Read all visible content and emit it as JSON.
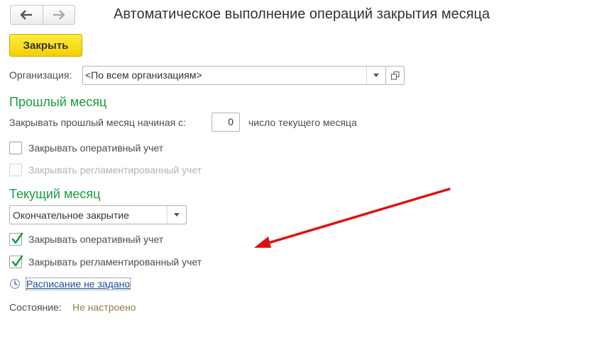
{
  "window": {
    "title": "Автоматическое выполнение операций закрытия месяца"
  },
  "nav": {
    "back_icon": "arrow-left-icon",
    "forward_icon": "arrow-right-icon"
  },
  "toolbar": {
    "close_label": "Закрыть"
  },
  "organization": {
    "label": "Организация:",
    "value": "<По всем организациям>"
  },
  "previous_month": {
    "title": "Прошлый месяц",
    "start_label": "Закрывать прошлый месяц начиная с:",
    "start_value": "0",
    "start_suffix": "число текущего месяца",
    "operational": {
      "label": "Закрывать оперативный учет",
      "checked": false,
      "enabled": true
    },
    "regulated": {
      "label": "Закрывать регламентированный учет",
      "checked": false,
      "enabled": false
    }
  },
  "current_month": {
    "title": "Текущий месяц",
    "mode": "Окончательное закрытие",
    "operational": {
      "label": "Закрывать оперативный учет",
      "checked": true,
      "enabled": true
    },
    "regulated": {
      "label": "Закрывать регламентированный учет",
      "checked": true,
      "enabled": true
    }
  },
  "schedule": {
    "link": "Расписание не задано",
    "icon": "clock-icon"
  },
  "status": {
    "label": "Состояние:",
    "value": "Не настроено"
  },
  "colors": {
    "section_heading": "#1a9e3f",
    "close_button": "#f5d000",
    "link": "#1d4fa0",
    "status_value": "#8c7e4e",
    "annotation_arrow": "#e01010"
  }
}
